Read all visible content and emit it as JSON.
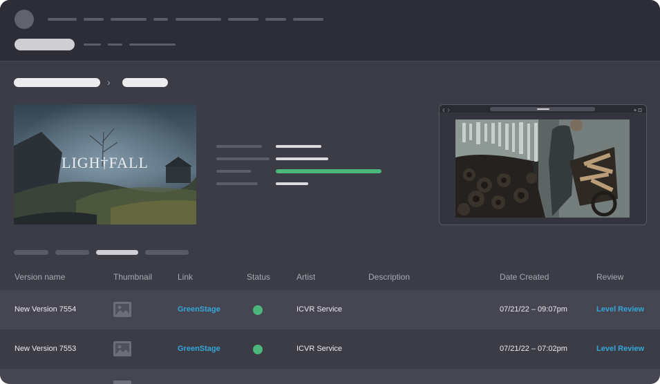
{
  "theme": {
    "accent_link": "#32a8d8",
    "status_green": "#4cb77a",
    "bg": "#3c3c47",
    "header_bg": "#2d2d38"
  },
  "hero": {
    "title": "LIGH†FALL"
  },
  "table": {
    "columns": [
      "Version name",
      "Thumbnail",
      "Link",
      "Status",
      "Artist",
      "Description",
      "Date Created",
      "Review"
    ],
    "rows": [
      {
        "version": "New Version 7554",
        "thumbnail": "image-icon",
        "link": "GreenStage",
        "status": "green",
        "artist": "ICVR Service",
        "description": "",
        "date": "07/21/22 – 09:07pm",
        "review": "Level Review"
      },
      {
        "version": "New Version 7553",
        "thumbnail": "image-icon",
        "link": "GreenStage",
        "status": "green",
        "artist": "ICVR Service",
        "description": "",
        "date": "07/21/22 – 07:02pm",
        "review": "Level Review"
      }
    ]
  }
}
